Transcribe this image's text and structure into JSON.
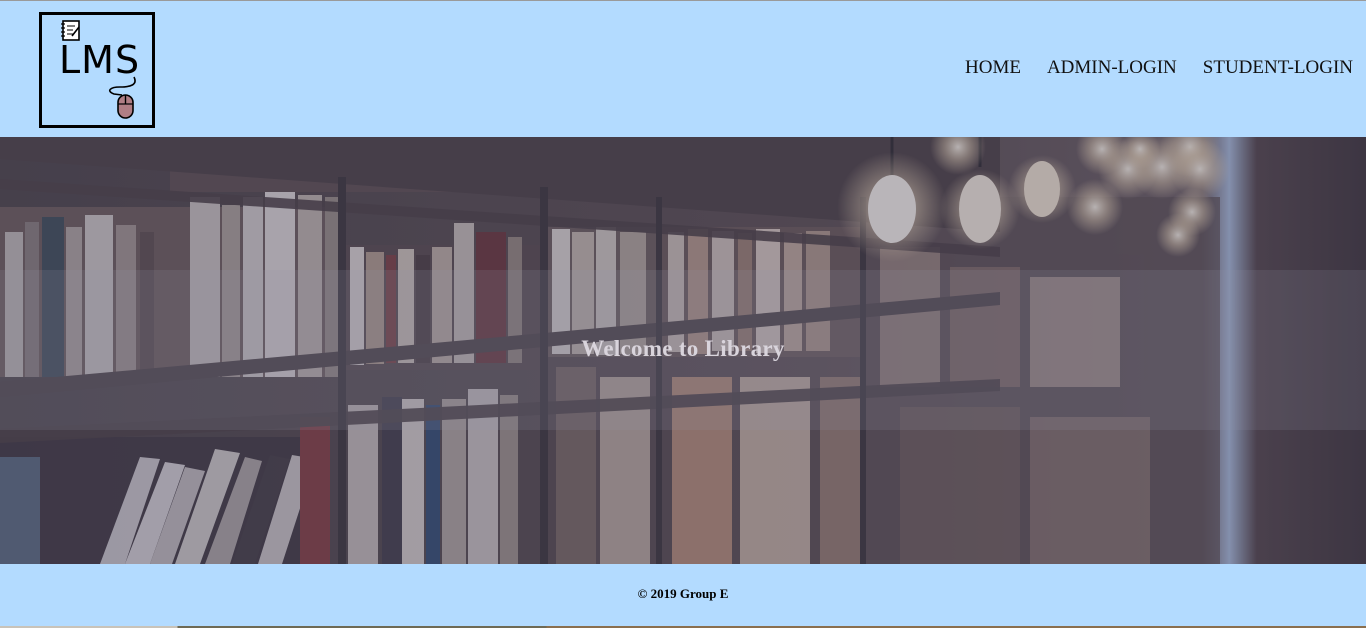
{
  "header": {
    "logo_text": "LMS",
    "nav": [
      {
        "label": "HOME"
      },
      {
        "label": "ADMIN-LOGIN"
      },
      {
        "label": "STUDENT-LOGIN"
      }
    ]
  },
  "hero": {
    "welcome": "Welcome to Library",
    "background_icon": "library-bookshelves-image"
  },
  "footer": {
    "copyright": "© 2019 Group E"
  },
  "colors": {
    "header_bg": "#b3dbff",
    "footer_bg": "#b3dbff",
    "hero_overlay": "#3e426c"
  }
}
